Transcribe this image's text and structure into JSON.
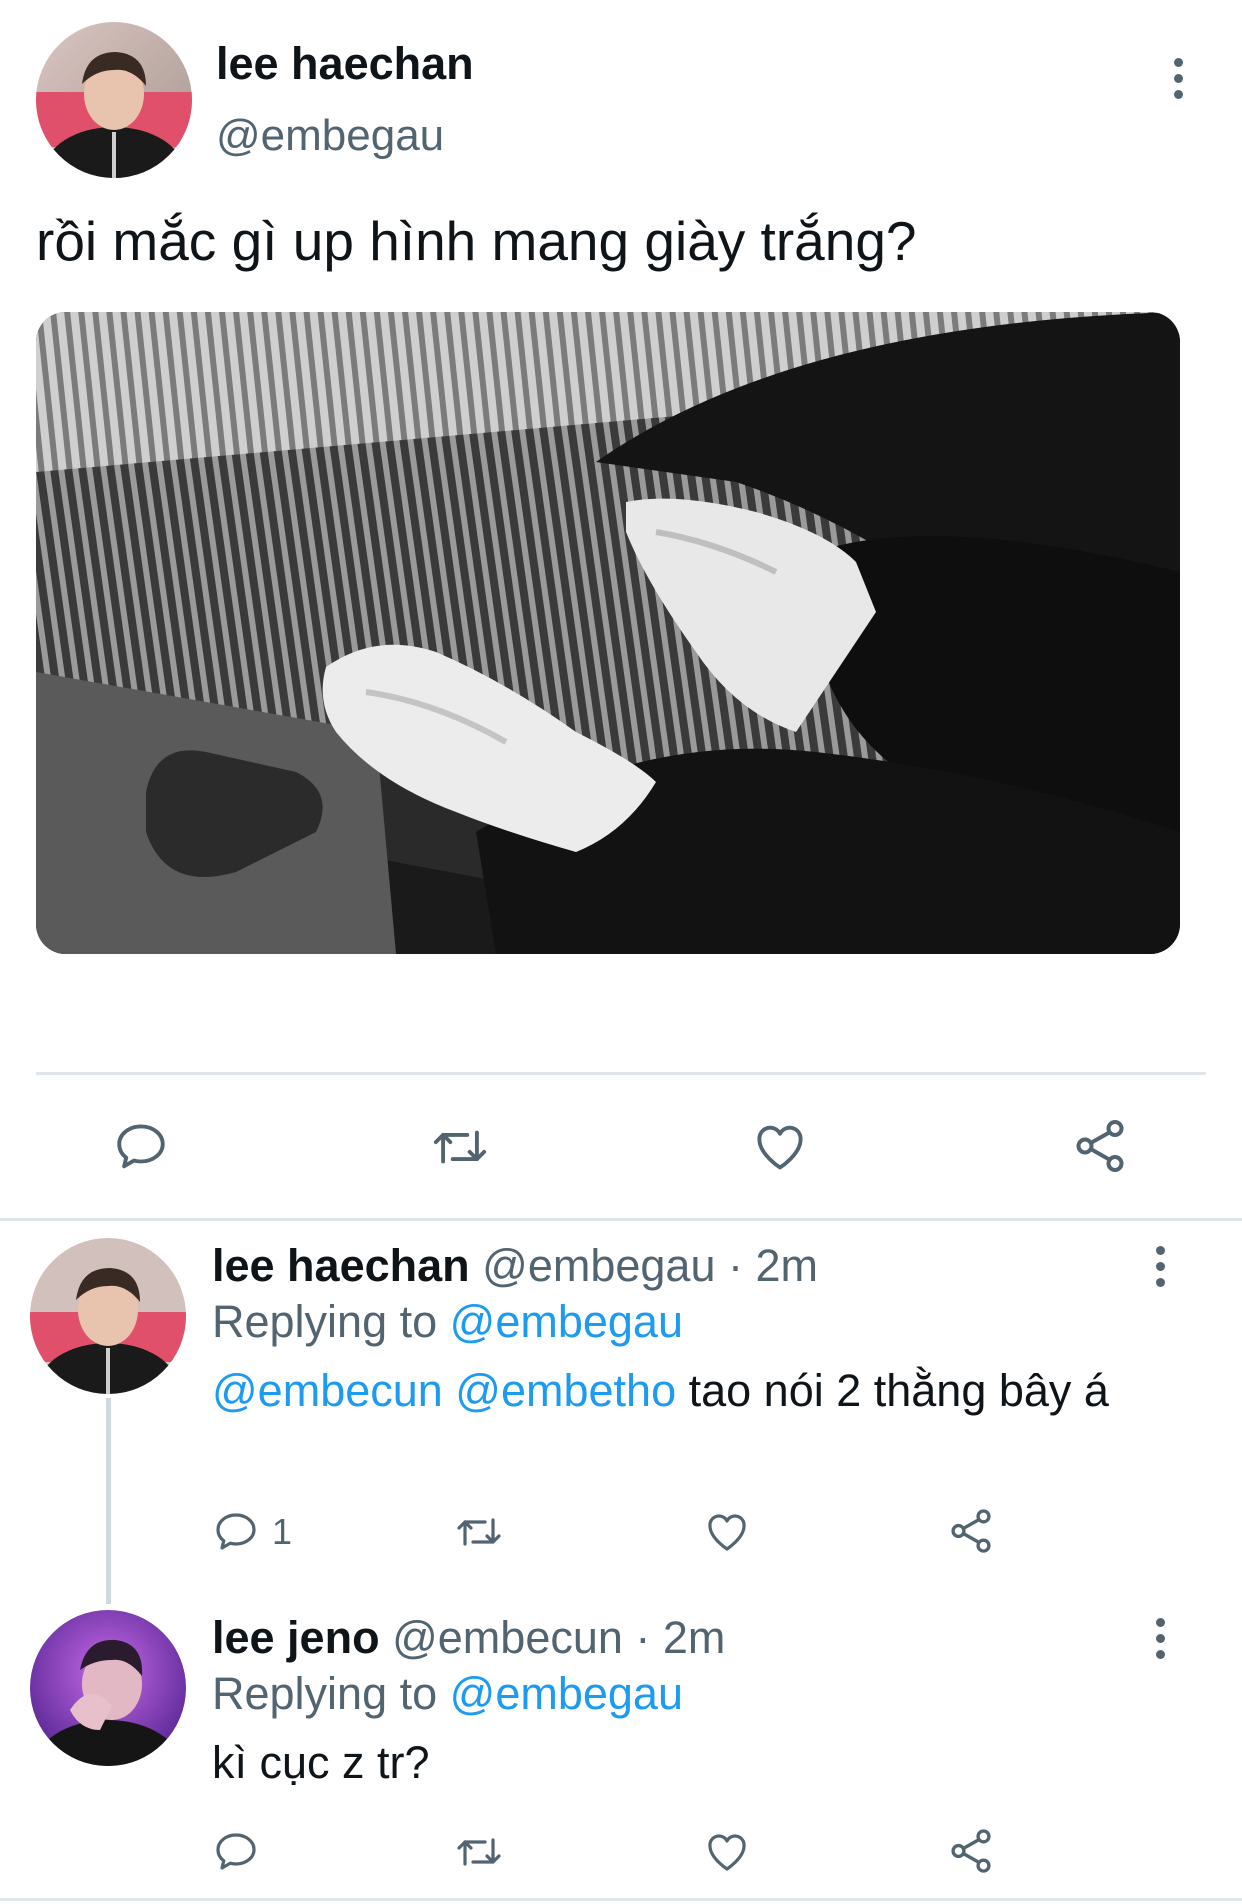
{
  "main_tweet": {
    "display_name": "lee haechan",
    "handle": "@embegau",
    "text": "rồi mắc gì up hình mang giày trắng?",
    "media_alt": "photo",
    "avatar_icon": "user-avatar-haechan"
  },
  "replies": [
    {
      "display_name": "lee haechan",
      "handle": "@embegau",
      "time": "· 2m",
      "replying_label": "Replying to",
      "replying_to": "@embegau",
      "mentions": "@embecun @embetho",
      "text": " tao nói 2 thằng bây á",
      "reply_count": "1"
    },
    {
      "display_name": "lee jeno",
      "handle": "@embecun",
      "time": "· 2m",
      "replying_label": "Replying to",
      "replying_to": "@embegau",
      "text": "kì cục z tr?"
    }
  ],
  "icons": {
    "reply": "reply-icon",
    "retweet": "retweet-icon",
    "like": "heart-icon",
    "share": "share-icon",
    "more": "more-vertical-icon"
  },
  "colors": {
    "accent": "#1d9bf0",
    "secondary_text": "#536471",
    "divider": "#e1e6ea"
  }
}
